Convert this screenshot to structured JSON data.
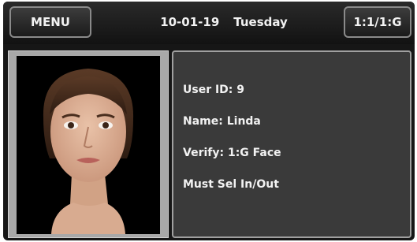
{
  "header": {
    "menu_label": "MENU",
    "date": "10-01-19",
    "day": "Tuesday",
    "mode_label": "1:1/1:G"
  },
  "user": {
    "id_line": "User ID: 9",
    "name_line": "Name: Linda",
    "verify_line": "Verify: 1:G Face",
    "status_line": "Must Sel In/Out"
  },
  "photo": {
    "icon": "face-photo"
  },
  "colors": {
    "screen_bg": "#161616",
    "panel_bg": "#3a3a3a",
    "text": "#f2f2f2",
    "border": "#a0a0a0"
  }
}
